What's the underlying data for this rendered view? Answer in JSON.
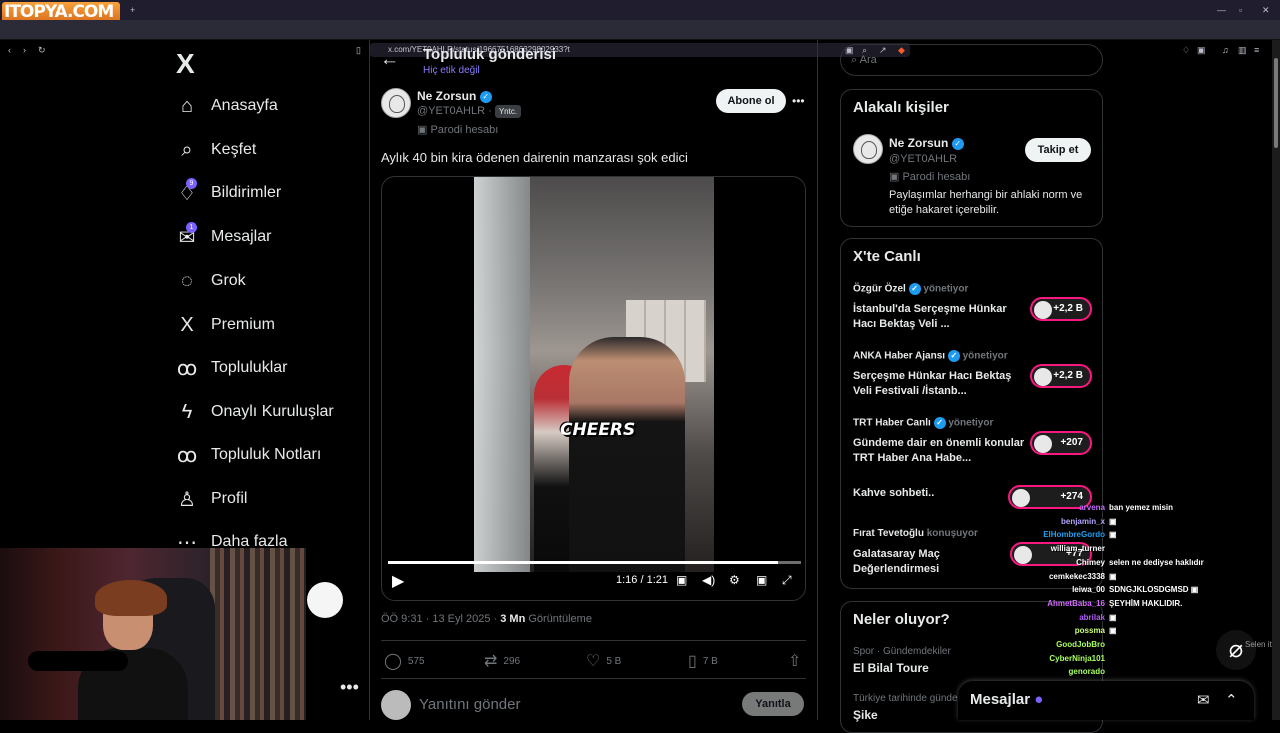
{
  "browser": {
    "watermark": "ITOPYA.COM",
    "url": "x.com/YET0AHLR/status/1966751686329802933?t",
    "tab_plus": "+",
    "window_controls": [
      "—",
      "▫",
      "✕"
    ]
  },
  "sidebar": {
    "logo": "X",
    "items": [
      {
        "label": "Anasayfa",
        "icon": "⌂"
      },
      {
        "label": "Keşfet",
        "icon": "⌕"
      },
      {
        "label": "Bildirimler",
        "icon": "♢",
        "badge": "9"
      },
      {
        "label": "Mesajlar",
        "icon": "✉",
        "badge": "1"
      },
      {
        "label": "Grok",
        "icon": "◌"
      },
      {
        "label": "Premium",
        "icon": "X"
      },
      {
        "label": "Topluluklar",
        "icon": "ꝏ"
      },
      {
        "label": "Onaylı Kuruluşlar",
        "icon": "ϟ"
      },
      {
        "label": "Topluluk Notları",
        "icon": "ꝏ"
      },
      {
        "label": "Profil",
        "icon": "♙"
      },
      {
        "label": "Daha fazla",
        "icon": "⋯"
      }
    ],
    "bottom_dots": "•••"
  },
  "main": {
    "header": {
      "title": "Topluluk gönderisi",
      "subtitle": "Hiç etik değil"
    },
    "post": {
      "name": "Ne Zorsun",
      "handle": "@YET0AHLR",
      "tag": "Yntc.",
      "parody": "Parodi hesabı",
      "follow_label": "Abone ol",
      "more_icon": "•••",
      "text": "Aylık 40 bin kira ödenen dairenin manzarası şok edici",
      "video_caption": "CHEERS",
      "video_progress": 0.944,
      "time": "1:16 / 1:21",
      "date": "ÖÖ 9:31 · 13 Eyl 2025 · ",
      "views": "3 Mn",
      "views_label": " Görüntüleme",
      "actions": [
        {
          "icon": "◯",
          "count": "575"
        },
        {
          "icon": "⇄",
          "count": "296"
        },
        {
          "icon": "♡",
          "count": "5 B"
        },
        {
          "icon": "▯",
          "count": "7 B"
        },
        {
          "icon": "⇧",
          "count": ""
        }
      ],
      "reply_placeholder": "Yanıtını gönder",
      "reply_button": "Yanıtla"
    }
  },
  "right": {
    "search_placeholder": "Ara",
    "related": {
      "title": "Alakalı kişiler",
      "name": "Ne Zorsun",
      "handle": "@YET0AHLR",
      "parody": "Parodi hesabı",
      "follow_label": "Takip et",
      "bio": "Paylaşımlar herhangi bir ahlaki norm ve etiğe hakaret içerebilir."
    },
    "live": {
      "title": "X'te Canlı",
      "items": [
        {
          "host": "Özgür Özel",
          "status": "yönetiyor",
          "title": "İstanbul'da Serçeşme Hünkar Hacı Bektaş Veli ...",
          "count": "+2,2 B"
        },
        {
          "host": "ANKA Haber Ajansı",
          "status": "yönetiyor",
          "title": "Serçeşme Hünkar Hacı Bektaş Veli Festivali /İstanb...",
          "count": "+2,2 B"
        },
        {
          "host": "TRT Haber Canlı",
          "status": "yönetiyor",
          "title": "Gündeme dair en önemli konular TRT Haber Ana Habe...",
          "count": "+207"
        },
        {
          "host": "",
          "status": "",
          "title": "Kahve sohbeti..",
          "count": "+274"
        },
        {
          "host": "Fırat Tevetoğlu",
          "status": "konuşuyor",
          "title": "Galatasaray Maç Değerlendirmesi",
          "count": "+77"
        }
      ]
    },
    "trends": {
      "title": "Neler oluyor?",
      "items": [
        {
          "context": "Spor · Gündemdekiler",
          "title": "El Bilal Toure"
        },
        {
          "context": "Türkiye tarihinde günde",
          "title": "Şike"
        }
      ]
    },
    "messages_dock": {
      "title": "Mesajlar",
      "compose_icon": "✉",
      "expand_icon": "⌃"
    }
  },
  "chat": [
    {
      "name": "arvena",
      "message": "ban yemez misin",
      "color": "#c46bff"
    },
    {
      "name": "benjamin_x",
      "message": "▣",
      "color": "#b3a4ff"
    },
    {
      "name": "ElHombreGordo",
      "message": "▣",
      "color": "#1da1f2"
    },
    {
      "name": "william_turner",
      "message": "",
      "color": "#fff"
    },
    {
      "name": "Chimey",
      "message": "selen ne dediyse haklıdır",
      "color": "#ffffff"
    },
    {
      "name": "cemkekec3338",
      "message": "▣",
      "color": "#ffffff"
    },
    {
      "name": "leiwa_00",
      "message": "SDNGJKLOSDGMSD ▣",
      "color": "#ffffff"
    },
    {
      "name": "AhmetBaba_16",
      "message": "ŞEYHİM HAKLIDIR.",
      "color": "#d66cff"
    },
    {
      "name": "abrilak",
      "message": "▣",
      "color": "#b45cff"
    },
    {
      "name": "possma",
      "message": "▣",
      "color": "#c9ff70"
    },
    {
      "name": "GoodJobBro",
      "message": "",
      "color": "#a6ff62"
    },
    {
      "name": "CyberNinja101",
      "message": "",
      "color": "#a6ff62"
    },
    {
      "name": "genorado",
      "message": "",
      "color": "#a6ff62"
    }
  ],
  "overlay": {
    "icon": "⌀",
    "text": "Selen itfi"
  }
}
